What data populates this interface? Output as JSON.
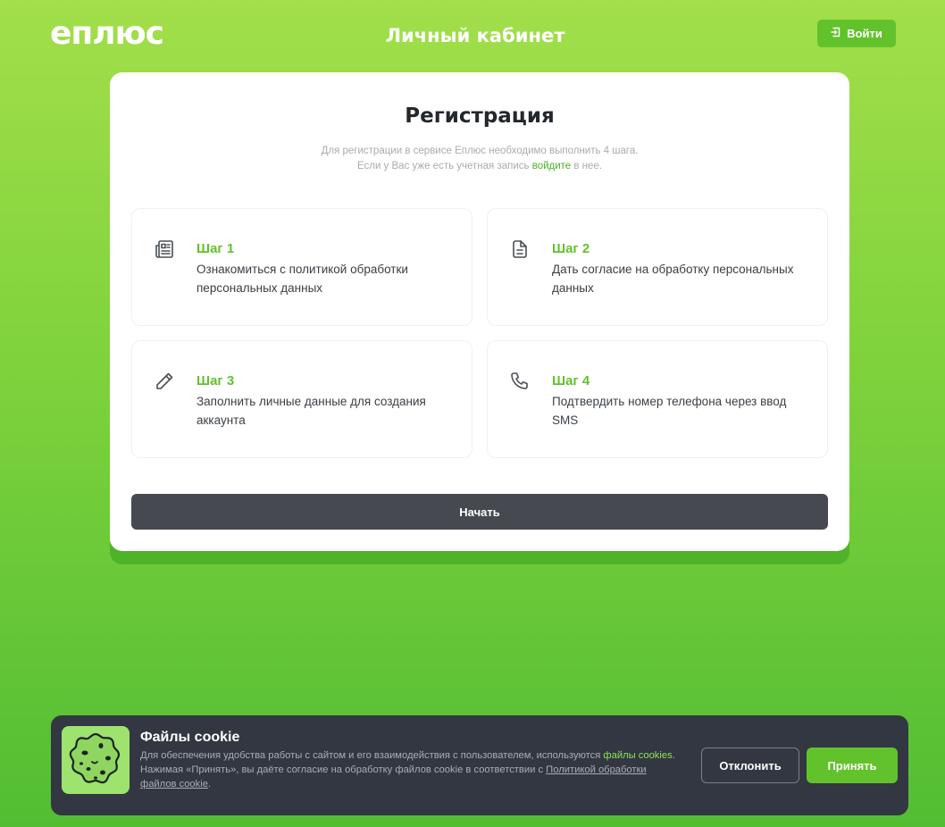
{
  "header": {
    "logo": "еплюс",
    "title": "Личный кабинет",
    "login_label": "Войти"
  },
  "registration": {
    "title": "Регистрация",
    "desc_prefix": "Для регистрации в сервисе Еплюс необходимо выполнить 4 шага. Если у Вас уже есть учетная запись ",
    "desc_link": "войдите",
    "desc_suffix": " в нее.",
    "steps": [
      {
        "title": "Шаг 1",
        "text": "Ознакомиться с политикой обработки персональных данных",
        "icon": "newspaper-icon"
      },
      {
        "title": "Шаг 2",
        "text": "Дать согласие на обработку персональных данных",
        "icon": "document-icon"
      },
      {
        "title": "Шаг 3",
        "text": "Заполнить личные данные для создания аккаунта",
        "icon": "pencil-icon"
      },
      {
        "title": "Шаг 4",
        "text": "Подтвердить номер телефона через ввод SMS",
        "icon": "phone-icon"
      }
    ],
    "start_label": "Начать"
  },
  "cookie": {
    "title": "Файлы cookie",
    "text_1": "Для обеспечения удобства работы с сайтом и его взаимодействия с пользователем, используются ",
    "link_1": "файлы cookies",
    "text_2": ". Нажимая «Принять», вы даёте согласие на обработку файлов cookie в соответствии с ",
    "link_2": "Политикой обработки файлов cookie",
    "text_3": ".",
    "decline_label": "Отклонить",
    "accept_label": "Принять"
  },
  "colors": {
    "accent": "#62c22c",
    "dark": "#464a50",
    "banner": "#323741"
  }
}
